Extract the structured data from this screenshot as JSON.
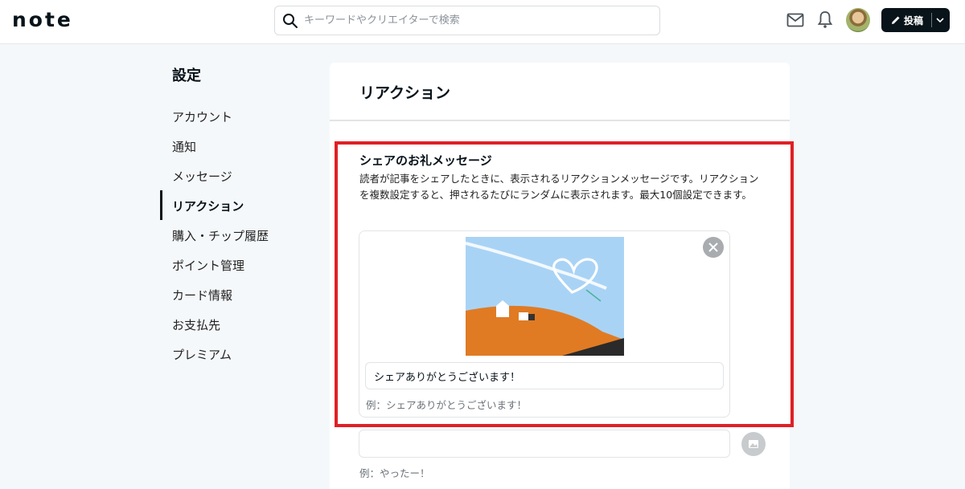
{
  "header": {
    "logo": "note",
    "search_placeholder": "キーワードやクリエイターで検索",
    "post_label": "投稿"
  },
  "sidebar": {
    "title": "設定",
    "items": [
      {
        "label": "アカウント"
      },
      {
        "label": "通知"
      },
      {
        "label": "メッセージ"
      },
      {
        "label": "リアクション",
        "active": true
      },
      {
        "label": "購入・チップ履歴"
      },
      {
        "label": "ポイント管理"
      },
      {
        "label": "カード情報"
      },
      {
        "label": "お支払先"
      },
      {
        "label": "プレミアム"
      }
    ]
  },
  "main": {
    "title": "リアクション",
    "section": {
      "title": "シェアのお礼メッセージ",
      "description": "読者が記事をシェアしたときに、表示されるリアクションメッセージです。リアクションを複数設定すると、押されるたびにランダムに表示されます。最大10個設定できます。",
      "message1_value": "シェアありがとうございます！",
      "example1": "例：シェアありがとうございます！",
      "message2_value": "",
      "example2": "例：やったー！"
    }
  },
  "colors": {
    "highlight": "#e02025",
    "dark": "#08131a"
  },
  "icons": [
    "search-icon",
    "mail-icon",
    "bell-icon",
    "pencil-icon",
    "chevron-down-icon",
    "close-icon",
    "image-icon"
  ]
}
